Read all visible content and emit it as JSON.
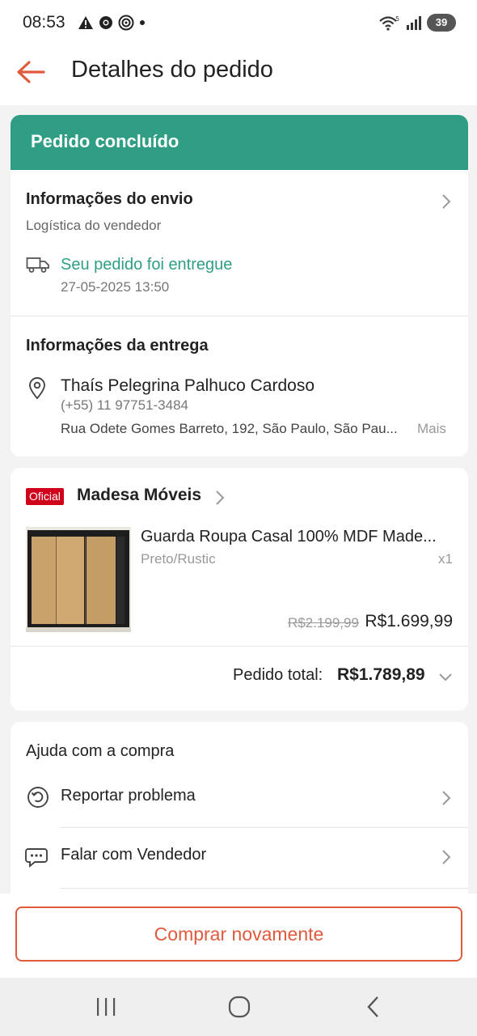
{
  "status_bar": {
    "time": "08:53",
    "battery": "39"
  },
  "header": {
    "title": "Detalhes do pedido"
  },
  "order_status": {
    "label": "Pedido concluído"
  },
  "shipping": {
    "title": "Informações do envio",
    "subtitle": "Logística do vendedor",
    "status": "Seu pedido foi entregue",
    "timestamp": "27-05-2025 13:50"
  },
  "delivery": {
    "title": "Informações da entrega",
    "name": "Thaís Pelegrina Palhuco Cardoso",
    "phone": "(+55) 11 97751-3484",
    "address": "Rua Odete Gomes Barreto, 192, São Paulo, São Pau...",
    "more": "Mais"
  },
  "seller": {
    "badge": "Oficial",
    "name": "Madesa Móveis"
  },
  "product": {
    "name": "Guarda Roupa Casal 100% MDF Made...",
    "variant": "Preto/Rustic",
    "quantity": "x1",
    "original_price": "R$2.199,99",
    "price": "R$1.699,99"
  },
  "order_total": {
    "label": "Pedido total:",
    "value": "R$1.789,89"
  },
  "help": {
    "title": "Ajuda com a compra",
    "items": [
      {
        "label": "Reportar problema",
        "icon": "report-problem-icon"
      },
      {
        "label": "Falar com Vendedor",
        "icon": "chat-seller-icon"
      }
    ]
  },
  "actions": {
    "buy_again": "Comprar novamente"
  },
  "colors": {
    "accent": "#e05a3c",
    "success": "#2f9e84",
    "official_badge": "#d0011b"
  }
}
